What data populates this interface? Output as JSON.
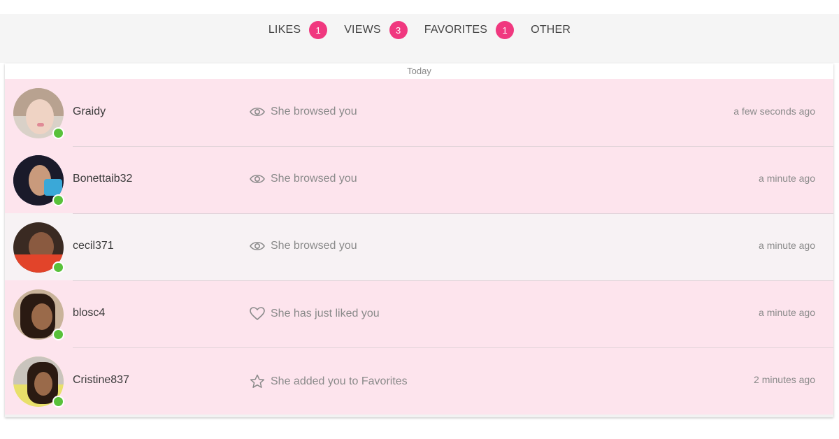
{
  "tabs": [
    {
      "label": "LIKES",
      "count": "1"
    },
    {
      "label": "VIEWS",
      "count": "3"
    },
    {
      "label": "FAVORITES",
      "count": "1"
    },
    {
      "label": "OTHER"
    }
  ],
  "section": {
    "day_label": "Today"
  },
  "activities": [
    {
      "username": "Graidy",
      "icon": "eye-icon",
      "text": "She browsed you",
      "time": "a few seconds ago",
      "online": true
    },
    {
      "username": "Bonettaib32",
      "icon": "eye-icon",
      "text": "She browsed you",
      "time": "a minute ago",
      "online": true
    },
    {
      "username": "cecil371",
      "icon": "eye-icon",
      "text": "She browsed you",
      "time": "a minute ago",
      "online": true
    },
    {
      "username": "blosc4",
      "icon": "heart-icon",
      "text": "She has just liked you",
      "time": "a minute ago",
      "online": true
    },
    {
      "username": "Cristine837",
      "icon": "star-icon",
      "text": "She added you to Favorites",
      "time": "2 minutes ago",
      "online": true
    }
  ],
  "colors": {
    "accent": "#f0387f",
    "unread_row": "#fde4ed",
    "read_row": "#f7f2f4",
    "online": "#59c13a"
  }
}
